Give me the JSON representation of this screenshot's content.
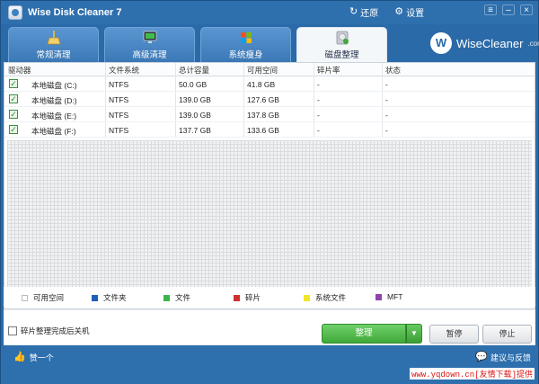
{
  "app": {
    "title": "Wise Disk Cleaner 7"
  },
  "titlebar": {
    "restore_label": "还原",
    "settings_label": "设置"
  },
  "tabs": [
    {
      "label": "常规清理",
      "icon": "broom-icon",
      "active": false
    },
    {
      "label": "高级清理",
      "icon": "monitor-icon",
      "active": false
    },
    {
      "label": "系统瘦身",
      "icon": "windows-logo-icon",
      "active": false
    },
    {
      "label": "磁盘整理",
      "icon": "disk-defrag-icon",
      "active": true
    }
  ],
  "brand": {
    "badge": "W",
    "name": "WiseCleaner",
    "domain": ".com"
  },
  "table": {
    "columns": [
      "驱动器",
      "文件系统",
      "总计容量",
      "可用空间",
      "碎片率",
      "状态"
    ],
    "rows": [
      {
        "checked": true,
        "drive": "本地磁盘 (C:)",
        "fs": "NTFS",
        "total": "50.0 GB",
        "free": "41.8 GB",
        "frag": "-",
        "status": "-"
      },
      {
        "checked": true,
        "drive": "本地磁盘 (D:)",
        "fs": "NTFS",
        "total": "139.0 GB",
        "free": "127.6 GB",
        "frag": "-",
        "status": "-"
      },
      {
        "checked": true,
        "drive": "本地磁盘 (E:)",
        "fs": "NTFS",
        "total": "139.0 GB",
        "free": "137.8 GB",
        "frag": "-",
        "status": "-"
      },
      {
        "checked": true,
        "drive": "本地磁盘 (F:)",
        "fs": "NTFS",
        "total": "137.7 GB",
        "free": "133.6 GB",
        "frag": "-",
        "status": "-"
      }
    ]
  },
  "legend": [
    {
      "label": "可用空间",
      "color": "#ffffff"
    },
    {
      "label": "文件夹",
      "color": "#1f5fb8"
    },
    {
      "label": "文件",
      "color": "#3bb54a"
    },
    {
      "label": "碎片",
      "color": "#d0312d"
    },
    {
      "label": "系统文件",
      "color": "#f2e52a"
    },
    {
      "label": "MFT",
      "color": "#8e44ad"
    }
  ],
  "controls": {
    "shutdown_label": "碎片整理完成后关机",
    "defrag_label": "整理",
    "pause_label": "暂停",
    "stop_label": "停止"
  },
  "statusbar": {
    "like_label": "赞一个",
    "feedback_label": "建议与反馈",
    "watermark": "www.yqdown.cn[友情下载]提供"
  }
}
